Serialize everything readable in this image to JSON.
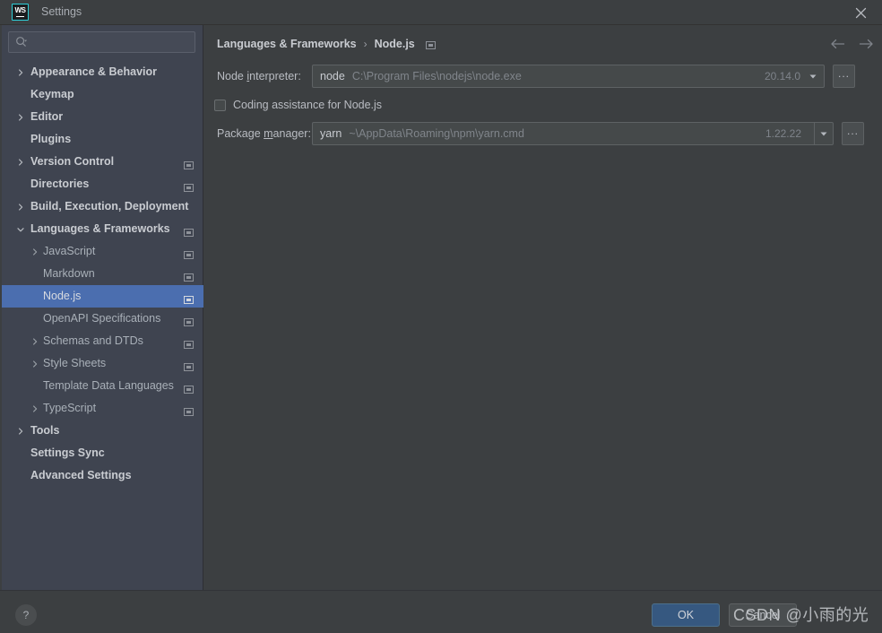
{
  "window": {
    "title": "Settings",
    "app_icon": "webstorm-icon",
    "app_icon_text": "WS",
    "close_icon": "close-icon"
  },
  "sidebar": {
    "search": {
      "placeholder": "",
      "value": "",
      "icon": "search-icon"
    },
    "items": [
      {
        "label": "Appearance & Behavior",
        "indent": 0,
        "arrow": "collapsed",
        "bold": true,
        "module_icon": false,
        "selected": false
      },
      {
        "label": "Keymap",
        "indent": 0,
        "arrow": "none",
        "bold": true,
        "module_icon": false,
        "selected": false
      },
      {
        "label": "Editor",
        "indent": 0,
        "arrow": "collapsed",
        "bold": true,
        "module_icon": false,
        "selected": false
      },
      {
        "label": "Plugins",
        "indent": 0,
        "arrow": "none",
        "bold": true,
        "module_icon": false,
        "selected": false
      },
      {
        "label": "Version Control",
        "indent": 0,
        "arrow": "collapsed",
        "bold": true,
        "module_icon": true,
        "selected": false
      },
      {
        "label": "Directories",
        "indent": 0,
        "arrow": "none",
        "bold": true,
        "module_icon": true,
        "selected": false
      },
      {
        "label": "Build, Execution, Deployment",
        "indent": 0,
        "arrow": "collapsed",
        "bold": true,
        "module_icon": false,
        "selected": false
      },
      {
        "label": "Languages & Frameworks",
        "indent": 0,
        "arrow": "expanded",
        "bold": true,
        "module_icon": true,
        "selected": false
      },
      {
        "label": "JavaScript",
        "indent": 1,
        "arrow": "collapsed",
        "bold": false,
        "module_icon": true,
        "selected": false
      },
      {
        "label": "Markdown",
        "indent": 1,
        "arrow": "none",
        "bold": false,
        "module_icon": true,
        "selected": false
      },
      {
        "label": "Node.js",
        "indent": 1,
        "arrow": "none",
        "bold": false,
        "module_icon": true,
        "selected": true
      },
      {
        "label": "OpenAPI Specifications",
        "indent": 1,
        "arrow": "none",
        "bold": false,
        "module_icon": true,
        "selected": false
      },
      {
        "label": "Schemas and DTDs",
        "indent": 1,
        "arrow": "collapsed",
        "bold": false,
        "module_icon": true,
        "selected": false
      },
      {
        "label": "Style Sheets",
        "indent": 1,
        "arrow": "collapsed",
        "bold": false,
        "module_icon": true,
        "selected": false
      },
      {
        "label": "Template Data Languages",
        "indent": 1,
        "arrow": "none",
        "bold": false,
        "module_icon": true,
        "selected": false
      },
      {
        "label": "TypeScript",
        "indent": 1,
        "arrow": "collapsed",
        "bold": false,
        "module_icon": true,
        "selected": false
      },
      {
        "label": "Tools",
        "indent": 0,
        "arrow": "collapsed",
        "bold": true,
        "module_icon": false,
        "selected": false
      },
      {
        "label": "Settings Sync",
        "indent": 0,
        "arrow": "none",
        "bold": true,
        "module_icon": false,
        "selected": false
      },
      {
        "label": "Advanced Settings",
        "indent": 0,
        "arrow": "none",
        "bold": true,
        "module_icon": false,
        "selected": false
      }
    ]
  },
  "main": {
    "breadcrumb": {
      "parent": "Languages & Frameworks",
      "separator": "›",
      "current": "Node.js",
      "module_icon": "project-module-icon"
    },
    "nav": {
      "back_icon": "arrow-left-icon",
      "forward_icon": "arrow-right-icon"
    },
    "node_interpreter": {
      "label_pre": "Node ",
      "label_mnemonic": "i",
      "label_post": "nterpreter:",
      "name": "node",
      "path": "C:\\Program Files\\nodejs\\node.exe",
      "version": "20.14.0",
      "dropdown_icon": "chevron-down-icon",
      "browse_label": "...",
      "browse_icon": "ellipsis-icon"
    },
    "coding_assistance": {
      "label": "Coding assistance for Node.js",
      "checked": false
    },
    "package_manager": {
      "label_pre": "Package ",
      "label_mnemonic": "m",
      "label_post": "anager:",
      "name": "yarn",
      "path": "~\\AppData\\Roaming\\npm\\yarn.cmd",
      "version": "1.22.22",
      "dropdown_icon": "chevron-down-icon",
      "browse_label": "...",
      "browse_icon": "ellipsis-icon"
    }
  },
  "footer": {
    "help_label": "?",
    "ok_label": "OK",
    "cancel_label": "Cancel",
    "watermark": "CSDN @小雨的光"
  },
  "colors": {
    "window_bg": "#3c3f41",
    "sidebar_bg": "#3f4450",
    "selection_blue": "#4b6eaf",
    "ok_button_blue": "#365880",
    "accent_cyan": "#2ecfd8",
    "text_primary": "#c9ccd1",
    "text_secondary": "#a9b0b8",
    "text_muted": "#80858b"
  }
}
